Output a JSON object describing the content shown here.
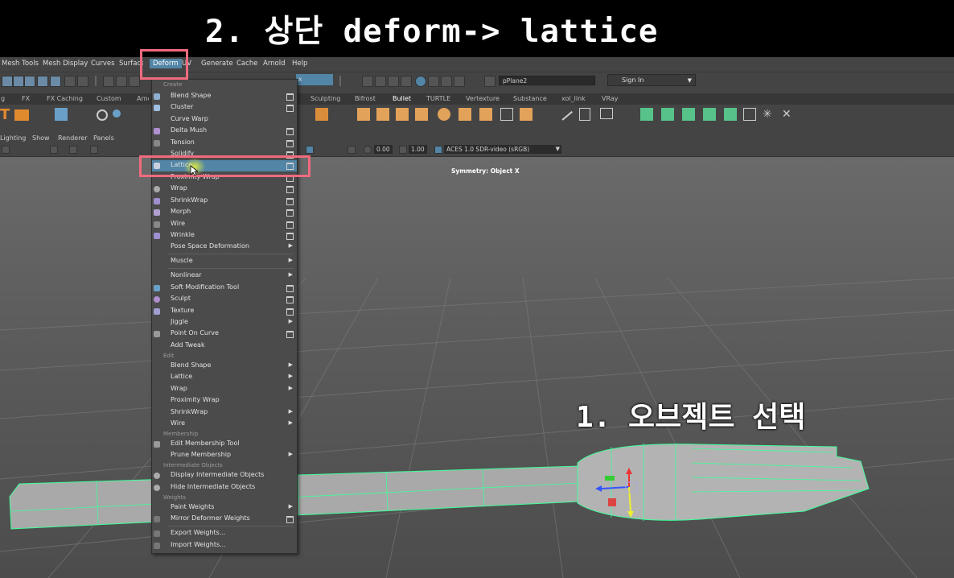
{
  "banner": {
    "text": "2. 상단 deform-> lattice"
  },
  "menubar": {
    "items": [
      "Mesh Tools",
      "Mesh Display",
      "Curves",
      "Surfaces",
      "Deform",
      "UV",
      "Generate",
      "Cache",
      "Arnold",
      "Help"
    ]
  },
  "statusline": {
    "object_field": "pPlane2",
    "sign_in": "Sign In"
  },
  "shelf": {
    "tabs": [
      "g",
      "FX",
      "FX Caching",
      "Custom",
      "Arnold",
      "Sculpting",
      "Bifrost",
      "Bullet",
      "TURTLE",
      "Vertexture",
      "Substance",
      "xol_link",
      "VRay"
    ],
    "active_tab": "Bullet"
  },
  "viewport": {
    "menus": [
      "Lighting",
      "Show",
      "Renderer",
      "Panels"
    ],
    "exposure": "0.00",
    "gamma": "1.00",
    "color_space": "ACES 1.0 SDR-video (sRGB)",
    "symmetry": "Symmetry: Object X"
  },
  "annotation": {
    "select_object": "1. 오브젝트 선택"
  },
  "deform_menu": {
    "sections": {
      "create": "Create",
      "edit": "Edit",
      "membership": "Membership",
      "intermediate": "Intermediate Objects",
      "weights": "Weights"
    },
    "items": [
      "Blend Shape",
      "Cluster",
      "Curve Warp",
      "Delta Mush",
      "Tension",
      "Solidify",
      "Lattice",
      "Proximity Wrap",
      "Wrap",
      "ShrinkWrap",
      "Morph",
      "Wire",
      "Wrinkle",
      "Pose Space Deformation",
      "Muscle",
      "Nonlinear",
      "Soft Modification Tool",
      "Sculpt",
      "Texture",
      "Jiggle",
      "Point On Curve",
      "Add Tweak",
      "Blend Shape",
      "Lattice",
      "Wrap",
      "Proximity Wrap",
      "ShrinkWrap",
      "Wire",
      "Edit Membership Tool",
      "Prune Membership",
      "Display Intermediate Objects",
      "Hide Intermediate Objects",
      "Paint Weights",
      "Mirror Deformer Weights",
      "Export Weights...",
      "Import Weights..."
    ],
    "highlighted": "Lattice"
  },
  "colors": {
    "highlight": "#5285a6",
    "annotation_box": "#f06a7e",
    "mesh_wire": "#3dff9a"
  }
}
